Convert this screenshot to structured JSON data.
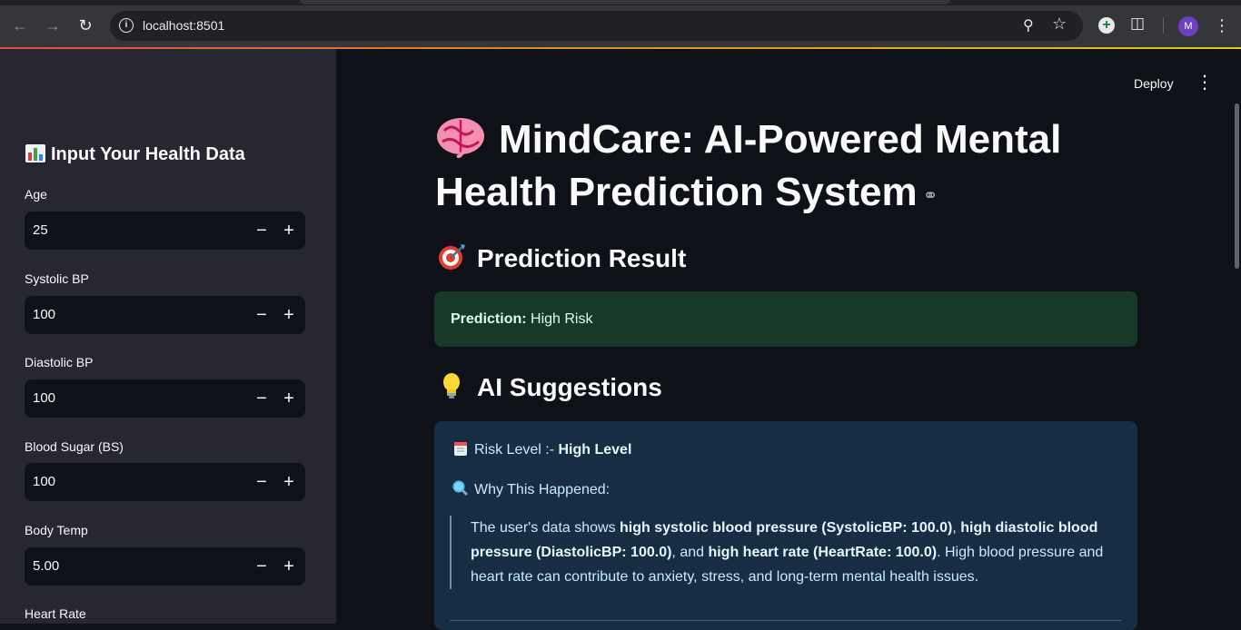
{
  "browser": {
    "url": "localhost:8501",
    "profile_initial": "M"
  },
  "colors": {
    "sidebar_bg": "#262730",
    "main_bg": "#0e1117",
    "success_bg": "#173928",
    "info_bg": "#172d43"
  },
  "header": {
    "deploy_label": "Deploy"
  },
  "sidebar": {
    "title": "Input Your Health Data",
    "title_icon": "bar-chart-icon",
    "fields": [
      {
        "label": "Age",
        "value": "25"
      },
      {
        "label": "Systolic BP",
        "value": "100"
      },
      {
        "label": "Diastolic BP",
        "value": "100"
      },
      {
        "label": "Blood Sugar (BS)",
        "value": "100"
      },
      {
        "label": "Body Temp",
        "value": "5.00"
      },
      {
        "label": "Heart Rate",
        "value": ""
      }
    ]
  },
  "main": {
    "title_line1": "MindCare: AI-Powered Mental",
    "title_line2": "Health Prediction System",
    "title_icon": "brain-icon",
    "prediction_heading": "Prediction Result",
    "prediction_label": "Prediction:",
    "prediction_value": "High Risk",
    "suggestions_heading": "AI Suggestions",
    "risk_label": "Risk Level :-",
    "risk_value": "High Level",
    "why_label": "Why This Happened:",
    "explanation": {
      "t1": "The user's data shows ",
      "b1": "high systolic blood pressure (SystolicBP: 100.0)",
      "t2": ", ",
      "b2": "high diastolic blood pressure (DiastolicBP: 100.0)",
      "t3": ", and ",
      "b3": "high heart rate (HeartRate: 100.0)",
      "t4": ". High blood pressure and heart rate can contribute to anxiety, stress, and long-term mental health issues."
    }
  }
}
